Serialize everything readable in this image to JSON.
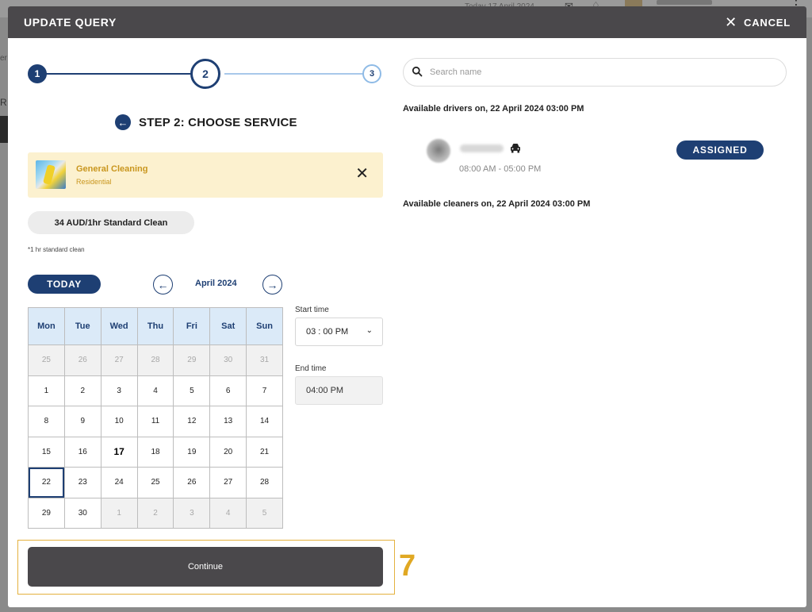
{
  "background": {
    "date_text": "Today 17 April 2024",
    "left_text_1": "er",
    "left_text_2": "R"
  },
  "modal": {
    "title": "UPDATE QUERY",
    "cancel_label": "CANCEL"
  },
  "stepper": {
    "steps": [
      "1",
      "2",
      "3"
    ],
    "current": 2,
    "title": "STEP 2: CHOOSE SERVICE"
  },
  "service": {
    "name": "General Cleaning",
    "category": "Residential"
  },
  "price": {
    "label": "34 AUD/1hr Standard Clean",
    "note": "*1 hr standard clean"
  },
  "calendar": {
    "today_label": "TODAY",
    "month_label": "April 2024",
    "weekdays": [
      "Mon",
      "Tue",
      "Wed",
      "Thu",
      "Fri",
      "Sat",
      "Sun"
    ],
    "weeks": [
      [
        "25",
        "26",
        "27",
        "28",
        "29",
        "30",
        "31"
      ],
      [
        "1",
        "2",
        "3",
        "4",
        "5",
        "6",
        "7"
      ],
      [
        "8",
        "9",
        "10",
        "11",
        "12",
        "13",
        "14"
      ],
      [
        "15",
        "16",
        "17",
        "18",
        "19",
        "20",
        "21"
      ],
      [
        "22",
        "23",
        "24",
        "25",
        "26",
        "27",
        "28"
      ],
      [
        "29",
        "30",
        "1",
        "2",
        "3",
        "4",
        "5"
      ]
    ],
    "other_month_cells": [
      [
        0,
        0
      ],
      [
        0,
        1
      ],
      [
        0,
        2
      ],
      [
        0,
        3
      ],
      [
        0,
        4
      ],
      [
        0,
        5
      ],
      [
        0,
        6
      ],
      [
        5,
        2
      ],
      [
        5,
        3
      ],
      [
        5,
        4
      ],
      [
        5,
        5
      ],
      [
        5,
        6
      ]
    ],
    "today_cell": [
      3,
      2
    ],
    "selected_cell": [
      4,
      0
    ]
  },
  "time": {
    "start_label": "Start time",
    "start_value": "03 : 00 PM",
    "end_label": "End time",
    "end_value": "04:00 PM"
  },
  "actions": {
    "continue_label": "Continue",
    "annotation_number": "7"
  },
  "search": {
    "placeholder": "Search name"
  },
  "drivers": {
    "heading": "Available drivers on, 22 April 2024 03:00 PM",
    "items": [
      {
        "name": "Cole Betts",
        "hours": "08:00 AM - 05:00 PM",
        "status": "ASSIGNED"
      }
    ]
  },
  "cleaners": {
    "heading": "Available cleaners on, 22 April 2024 03:00 PM"
  },
  "colors": {
    "primary": "#1e3f73",
    "header_dark": "#4a484b",
    "service_bg": "#fcf1cf",
    "service_text": "#c9961e",
    "annotation": "#e0a823"
  }
}
